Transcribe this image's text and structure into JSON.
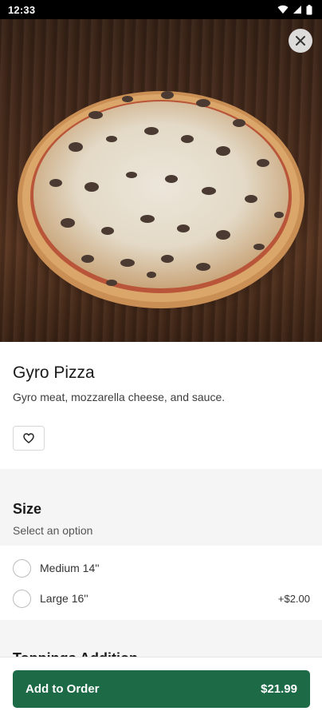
{
  "status_bar": {
    "time": "12:33",
    "icons": [
      "wifi-icon",
      "signal-icon",
      "battery-icon"
    ]
  },
  "hero": {
    "image": "gyro-pizza-photo"
  },
  "item": {
    "title": "Gyro Pizza",
    "description": "Gyro meat, mozzarella cheese, and sauce."
  },
  "size": {
    "title": "Size",
    "subtitle": "Select an option",
    "options": [
      {
        "label": "Medium 14''",
        "price": ""
      },
      {
        "label": "Large 16''",
        "price": "+$2.00"
      }
    ]
  },
  "toppings": {
    "title": "Toppings Addition"
  },
  "cta": {
    "label": "Add to Order",
    "price": "$21.99"
  },
  "colors": {
    "accent": "#1d6a46",
    "section_bg": "#f5f5f5"
  }
}
